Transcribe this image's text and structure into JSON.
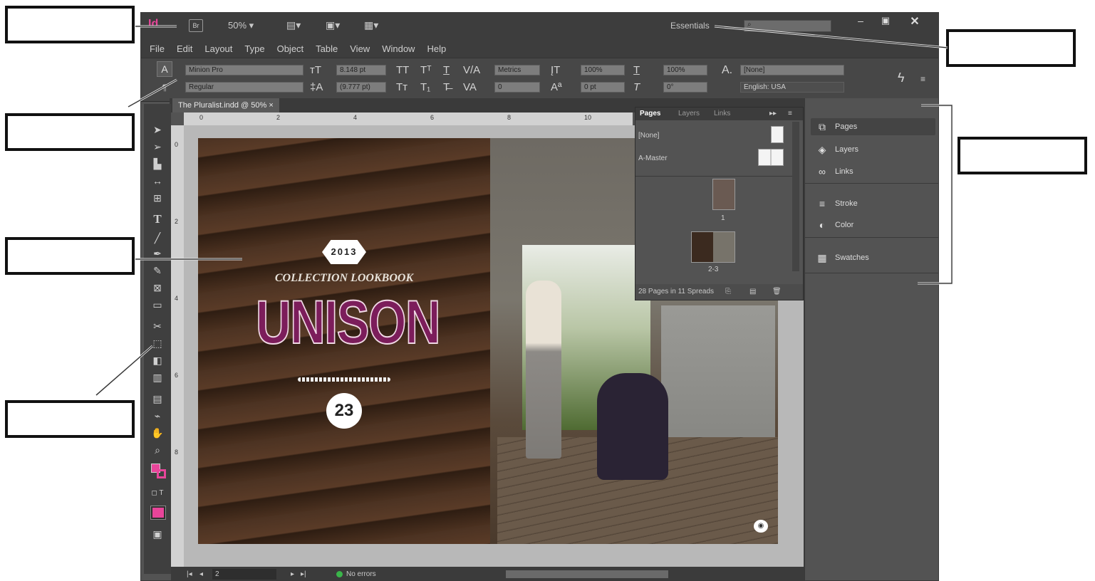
{
  "titlebar": {
    "app_logo": "Id",
    "bridge_label": "Br",
    "zoom": "50%",
    "workspace": "Essentials",
    "window_controls": [
      "minimize-icon",
      "restore-icon",
      "close-icon"
    ]
  },
  "menu": [
    "File",
    "Edit",
    "Layout",
    "Type",
    "Object",
    "Table",
    "View",
    "Window",
    "Help"
  ],
  "control_panel": {
    "font_family": "Minion Pro",
    "font_style": "Regular",
    "font_size": "8.148 pt",
    "leading": "(9.777 pt)",
    "kerning": "Metrics",
    "tracking": "0",
    "vertical_scale": "100%",
    "horizontal_scale": "100%",
    "baseline_shift": "0 pt",
    "skew": "0°",
    "char_style": "[None]",
    "language": "English: USA"
  },
  "document_tab": {
    "title": "The Pluralist.indd @ 50%",
    "close": "×"
  },
  "ruler_ticks": [
    "0",
    "2",
    "4",
    "6",
    "8",
    "10"
  ],
  "ruler_v_ticks": [
    "0",
    "2",
    "4",
    "6",
    "8"
  ],
  "artwork": {
    "year": "2013",
    "subtitle": "COLLECTION LOOKBOOK",
    "title": "UNISON",
    "issue": "23"
  },
  "pages_panel": {
    "tabs": [
      "Pages",
      "Layers",
      "Links"
    ],
    "masters": [
      "[None]",
      "A-Master"
    ],
    "page_labels": [
      "1",
      "2-3"
    ],
    "summary": "28 Pages in 11 Spreads"
  },
  "dock": {
    "groups": [
      {
        "items": [
          {
            "icon": "pages-icon",
            "label": "Pages"
          },
          {
            "icon": "layers-icon",
            "label": "Layers"
          },
          {
            "icon": "links-icon",
            "label": "Links"
          }
        ]
      },
      {
        "items": [
          {
            "icon": "stroke-icon",
            "label": "Stroke"
          },
          {
            "icon": "color-icon",
            "label": "Color"
          }
        ]
      },
      {
        "items": [
          {
            "icon": "swatches-icon",
            "label": "Swatches"
          }
        ]
      }
    ]
  },
  "statusbar": {
    "page": "2",
    "preflight": "No errors"
  },
  "colors": {
    "ui_dark": "#3d3d3d",
    "ui_mid": "#535353",
    "indesign_pink": "#e8459a",
    "unison_magenta": "#7c1d5b"
  }
}
